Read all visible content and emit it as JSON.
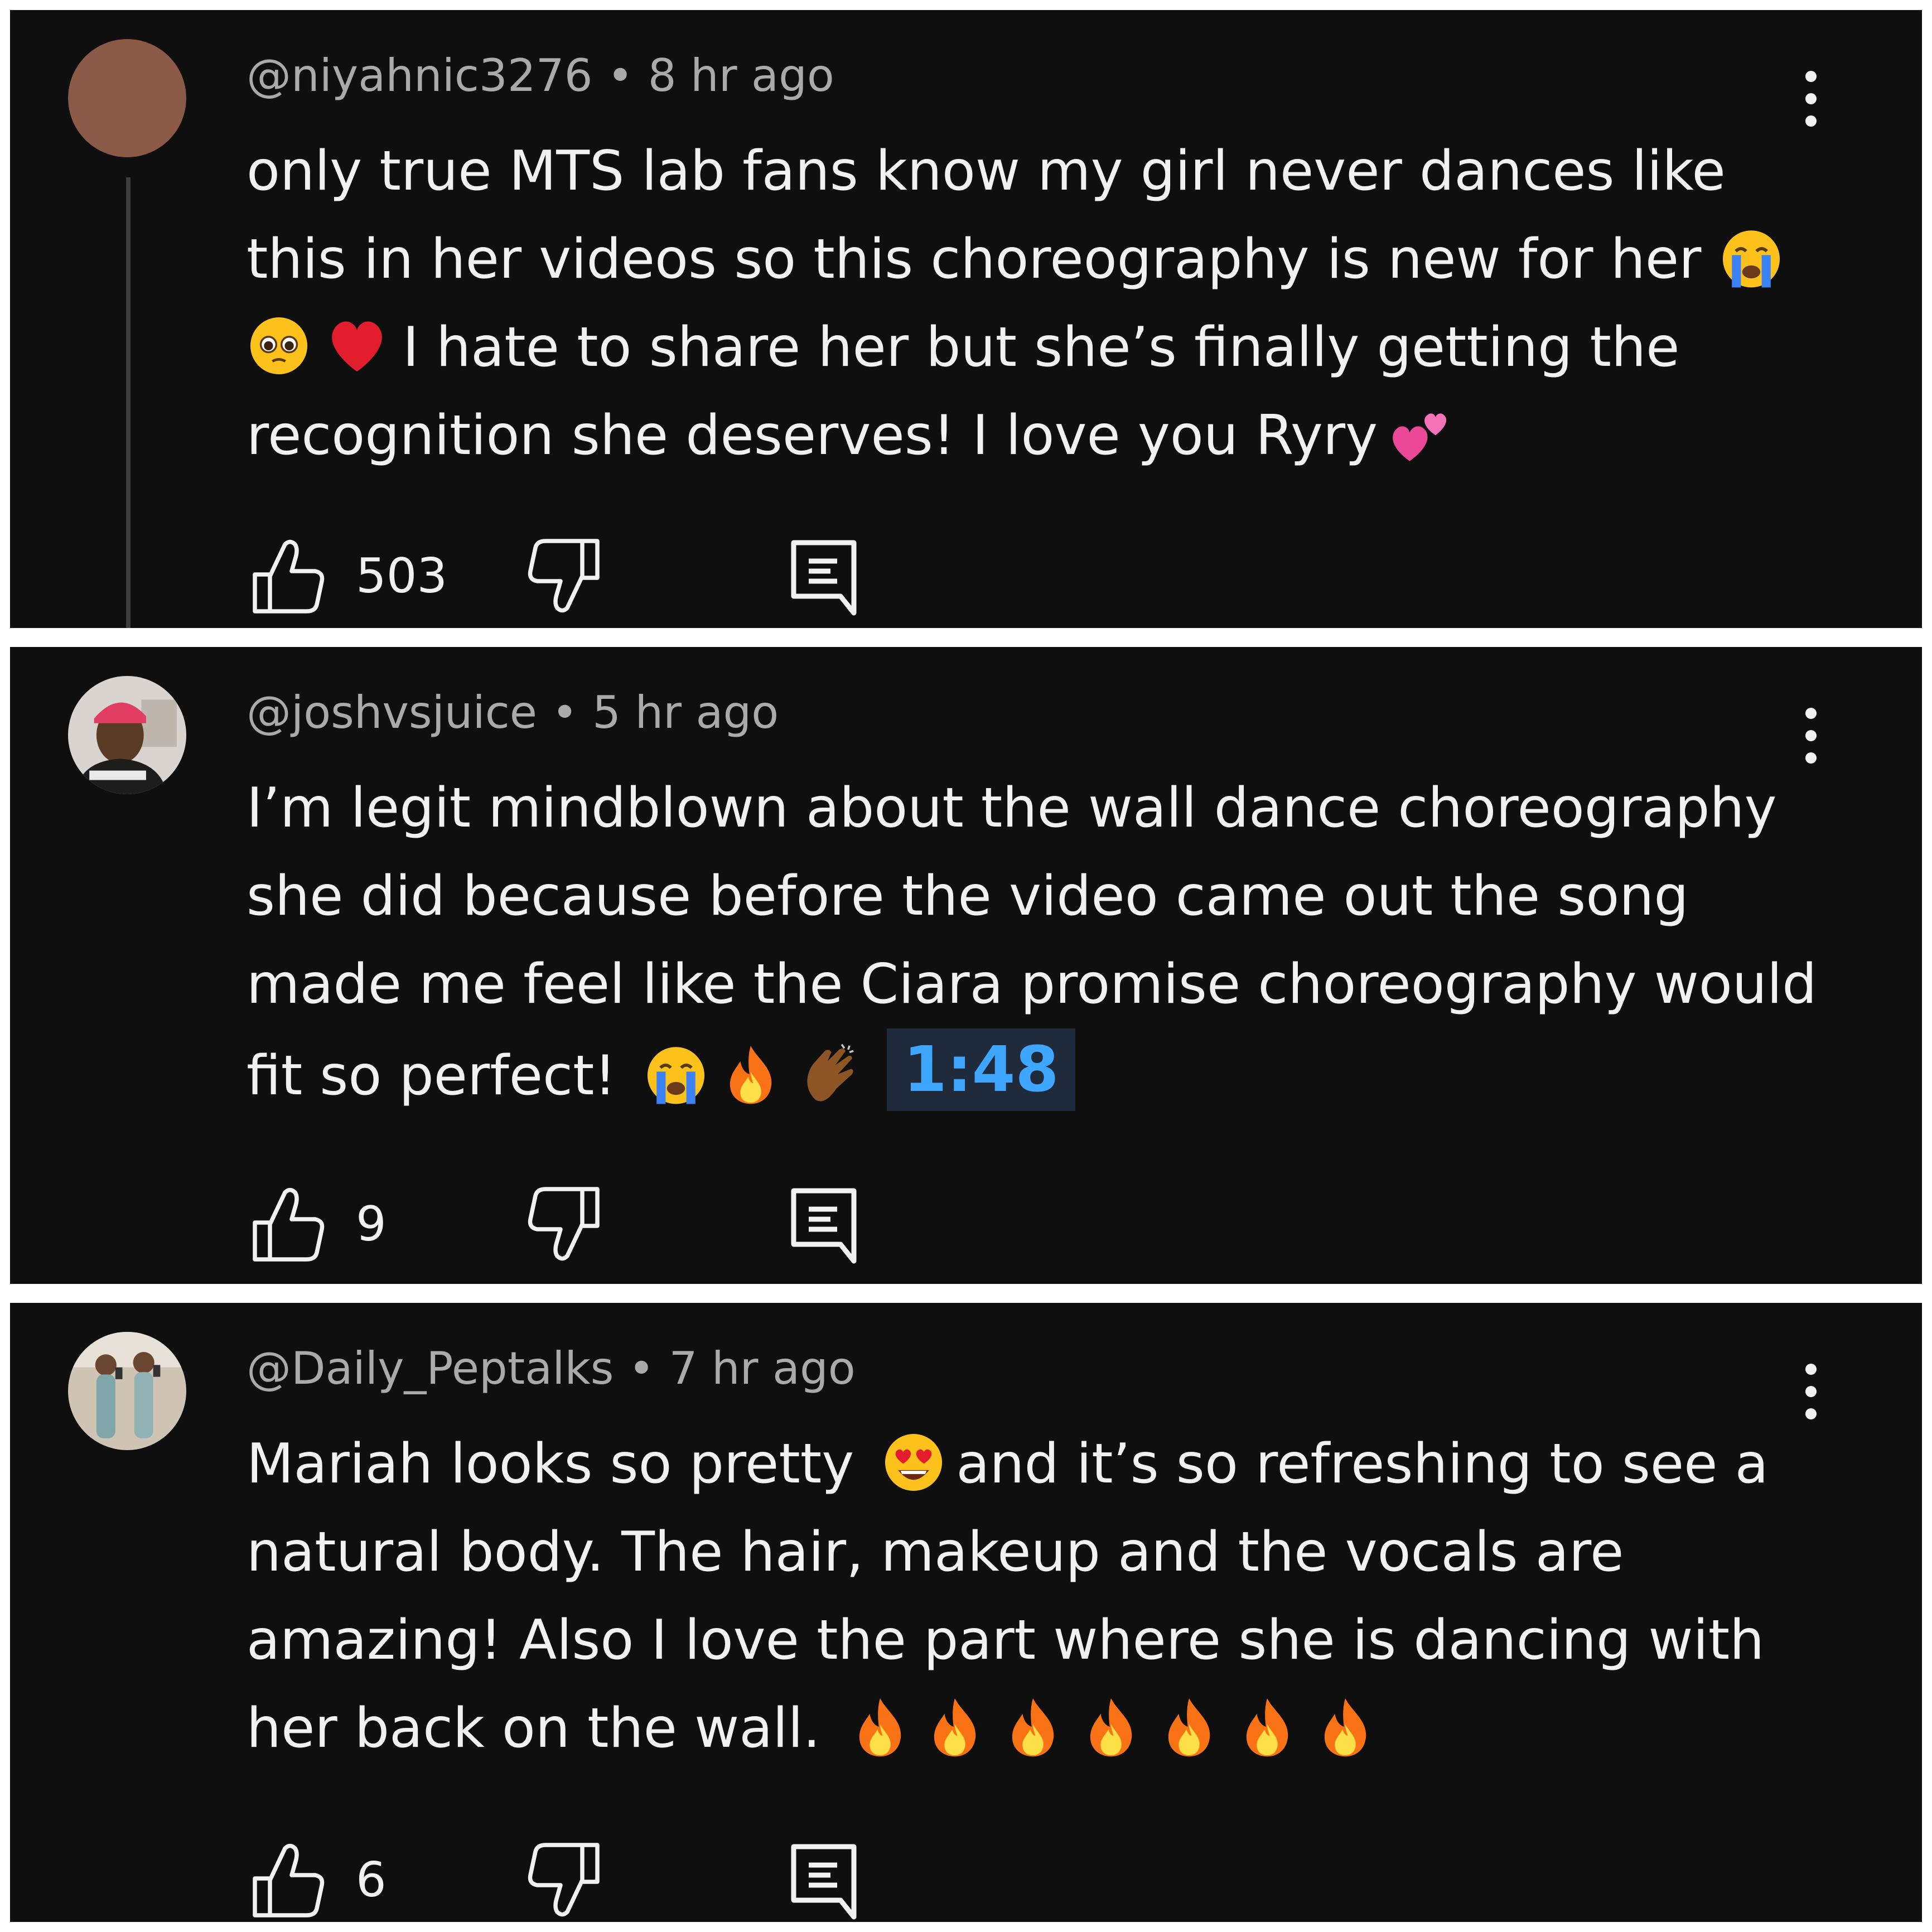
{
  "comments": [
    {
      "handle": "@niyahnic3276",
      "separator": "•",
      "time": "8 hr ago",
      "text": {
        "line1": "only true MTS lab fans know my girl never dances like this in her videos so this choreography is new for her",
        "after_emoji": "I hate to share her but she’s finally getting the recognition she deserves! I love you Ryry"
      },
      "emojis": [
        "crying-face-emoji",
        "pleading-face-emoji",
        "red-heart-emoji",
        "two-hearts-emoji"
      ],
      "likes": "503",
      "avatar": "solid-brown-avatar",
      "avatar_color": "#8a5a46",
      "has_thread_line": true
    },
    {
      "handle": "@joshvsjuice",
      "separator": "•",
      "time": "5 hr ago",
      "text": {
        "main": "I’m legit mindblown about the wall dance choreography she did because before the video came out the song made me feel like the Ciara promise choreography would fit so perfect!"
      },
      "timestamp_link": "1:48",
      "emojis": [
        "crying-face-emoji",
        "fire-emoji",
        "clapping-hands-emoji"
      ],
      "likes": "9",
      "avatar": "person-photo-avatar"
    },
    {
      "handle": "@Daily_Peptalks",
      "separator": "•",
      "time": "7 hr ago",
      "text": {
        "before_emoji": "Mariah looks so pretty",
        "after_emoji": "and it’s so refreshing to see a natural body. The hair, makeup and the vocals are amazing! Also I love the part where she is dancing with her back on the wall."
      },
      "emojis": [
        "heart-eyes-emoji",
        "fire-emoji x7"
      ],
      "likes": "6",
      "avatar": "two-women-photo-avatar"
    }
  ],
  "colors": {
    "background": "#0f0f0f",
    "text": "#f1f1f1",
    "meta_text": "#aaaaaa",
    "link": "#3ea6ff",
    "link_bg": "#1f2b3b",
    "frame": "#ffffff"
  }
}
